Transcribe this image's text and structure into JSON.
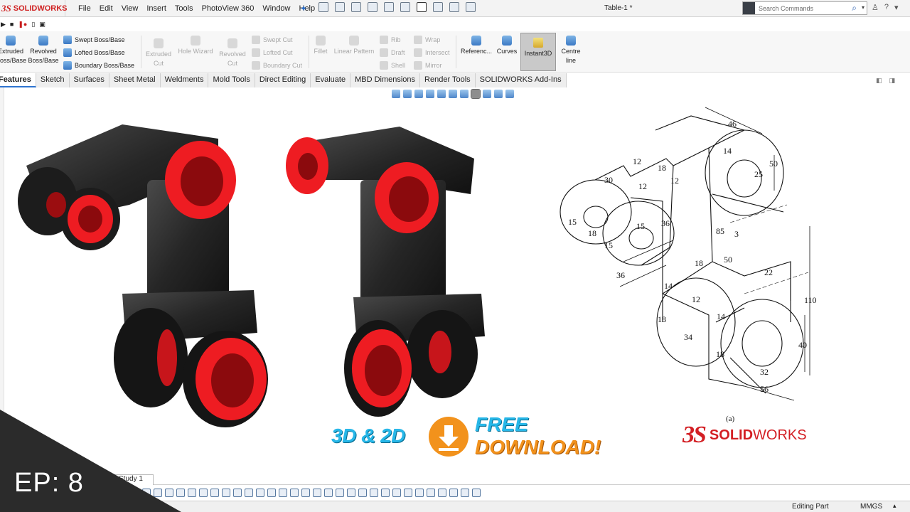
{
  "app": {
    "logo_text": "SOLIDWORKS",
    "doc_title": "Table-1 *"
  },
  "menu": [
    "File",
    "Edit",
    "View",
    "Insert",
    "Tools",
    "PhotoView 360",
    "Window",
    "Help"
  ],
  "search": {
    "placeholder": "Search Commands"
  },
  "top_right": [
    "?"
  ],
  "commands": {
    "extruded": "Extruded Boss/Base",
    "revolved": "Revolved Boss/Base",
    "swept": "Swept Boss/Base",
    "lofted": "Lofted Boss/Base",
    "boundary": "Boundary Boss/Base",
    "extruded_cut": "Extruded Cut",
    "hole_wizard": "Hole Wizard",
    "revolved_cut": "Revolved Cut",
    "swept_cut": "Swept Cut",
    "lofted_cut": "Lofted Cut",
    "boundary_cut": "Boundary Cut",
    "fillet": "Fillet",
    "linear_pattern": "Linear Pattern",
    "rib": "Rib",
    "draft": "Draft",
    "shell": "Shell",
    "wrap": "Wrap",
    "intersect": "Intersect",
    "mirror": "Mirror",
    "reference": "Referenc...",
    "curves": "Curves",
    "instant3d": "Instant3D",
    "centreline": "Centre line"
  },
  "tabs": [
    "Features",
    "Sketch",
    "Surfaces",
    "Sheet Metal",
    "Weldments",
    "Mold Tools",
    "Direct Editing",
    "Evaluate",
    "MBD Dimensions",
    "Render Tools",
    "SOLIDWORKS Add-Ins"
  ],
  "drawing": {
    "dims": [
      "46",
      "50",
      "25",
      "14",
      "12",
      "18",
      "12",
      "30",
      "12",
      "15",
      "18",
      "15",
      "36",
      "15",
      "85",
      "3",
      "50",
      "36",
      "18",
      "22",
      "14",
      "12",
      "110",
      "18",
      "14",
      "34",
      "18",
      "40",
      "32",
      "56"
    ],
    "caption": "(a)"
  },
  "promo": {
    "line1": "3D & 2D",
    "free": "FREE",
    "download": "DOWNLOAD!"
  },
  "brand": {
    "ds": "3S",
    "solid": "SOLID",
    "works": "WORKS"
  },
  "motion_tab": "Study 1",
  "status": {
    "mode": "Editing Part",
    "units": "MMGS"
  },
  "episode": "EP: 8",
  "colors": {
    "accent_red": "#e4161c",
    "part_black": "#262626",
    "promo_blue": "#27b7e8",
    "promo_orange": "#f2921c",
    "banner": "#2b2b2b"
  }
}
